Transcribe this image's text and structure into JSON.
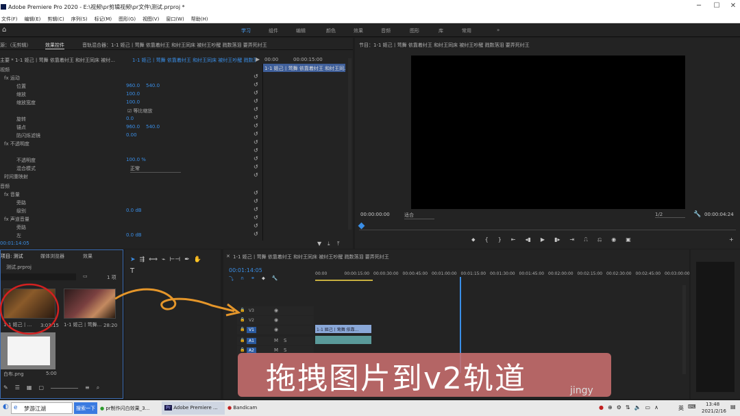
{
  "window": {
    "title": "Adobe Premiere Pro 2020 - E:\\视频\\pr剪辑视频\\pr文件\\测试.prproj *"
  },
  "menu": [
    "文件(F)",
    "编辑(E)",
    "剪辑(C)",
    "序列(S)",
    "标记(M)",
    "图形(G)",
    "视图(V)",
    "窗口(W)",
    "帮助(H)"
  ],
  "workspaces": [
    "学习",
    "组件",
    "编辑",
    "颜色",
    "效果",
    "音频",
    "图形",
    "库",
    "常用"
  ],
  "workspace_more": "»",
  "source_panel": {
    "tab_source": "源：（无剪辑）",
    "tab_effect_controls": "效果控件",
    "tab_audio_mixer": "音轨混合器：1-1 姬己丨莺舞 依靠着纣王 和纣王同床 被纣王吵醒 戮数落泪 要弄死纣王",
    "header_left": "主要 * 1-1 姬己丨莺舞 依靠着纣王 和纣王同床 被纣...",
    "header_right": "1-1 姬己丨莺舞 依靠着纣王 和纣王同床 被纣王吵醒 戮数落泪 ...",
    "time_a": "00:00",
    "time_b": "00:00:15:00",
    "clip_bar": "1-1 姬己丨莺舞 依靠着纣王 和纣王同...",
    "current_time": "00:01:14:05",
    "rows": [
      {
        "label": "视频",
        "value": "",
        "value2": "",
        "indent": 0
      },
      {
        "label": "fx 运动",
        "value": "",
        "value2": "",
        "indent": 1
      },
      {
        "label": "位置",
        "value": "960.0",
        "value2": "540.0",
        "indent": 2
      },
      {
        "label": "缩放",
        "value": "100.0",
        "value2": "",
        "indent": 2
      },
      {
        "label": "缩放宽度",
        "value": "100.0",
        "value2": "",
        "indent": 2
      },
      {
        "label": "☑ 等比缩放",
        "value": "",
        "value2": "",
        "indent": 4
      },
      {
        "label": "旋转",
        "value": "0.0",
        "value2": "",
        "indent": 2
      },
      {
        "label": "锚点",
        "value": "960.0",
        "value2": "540.0",
        "indent": 2
      },
      {
        "label": "防闪烁滤镜",
        "value": "0.00",
        "value2": "",
        "indent": 2
      },
      {
        "label": "fx 不透明度",
        "value": "",
        "value2": "",
        "indent": 1
      },
      {
        "label": "",
        "value": "",
        "value2": "",
        "indent": 2
      },
      {
        "label": "不透明度",
        "value": "100.0 %",
        "value2": "",
        "indent": 2
      },
      {
        "label": "混合模式",
        "value": "正常",
        "value2": "",
        "indent": 3
      },
      {
        "label": "时间重映射",
        "value": "",
        "value2": "",
        "indent": 1
      },
      {
        "label": "音频",
        "value": "",
        "value2": "",
        "indent": 0
      },
      {
        "label": "fx 音量",
        "value": "",
        "value2": "",
        "indent": 1
      },
      {
        "label": "旁路",
        "value": "",
        "value2": "",
        "indent": 2
      },
      {
        "label": "级别",
        "value": "0.0 dB",
        "value2": "",
        "indent": 2
      },
      {
        "label": "fx 声道音量",
        "value": "",
        "value2": "",
        "indent": 1
      },
      {
        "label": "旁路",
        "value": "",
        "value2": "",
        "indent": 2
      },
      {
        "label": "左",
        "value": "0.0 dB",
        "value2": "",
        "indent": 2
      }
    ]
  },
  "program": {
    "title": "节目：1-1 姬己丨莺舞 依靠着纣王 和纣王同床 被纣王吵醒 戮数落泪 要弄死纣王",
    "timecode_left": "00:00:00:00",
    "fit": "适合",
    "ratio": "1/2",
    "timecode_right": "00:00:04:24"
  },
  "project": {
    "tabs": [
      "项目: 测试",
      "媒体浏览器",
      "效果"
    ],
    "file": "测试.prproj",
    "count": "1 项",
    "items": [
      {
        "name": "1-1 姬己丨...",
        "duration": "3:03:15"
      },
      {
        "name": "1-1 姬己丨莺舞...",
        "duration": "28:20"
      },
      {
        "name": "白布.png",
        "duration": "5:00"
      }
    ]
  },
  "timeline": {
    "title": "1-1 姬己丨莺舞 依靠着纣王 和纣王同床 被纣王吵醒 戮数落泪 要弄死纣王",
    "current_time": "00:01:14:05",
    "ruler": [
      "00:00",
      "00:00:15:00",
      "00:00:30:00",
      "00:00:45:00",
      "00:01:00:00",
      "00:01:15:00",
      "00:01:30:00",
      "00:01:45:00",
      "00:02:00:00",
      "00:02:15:00",
      "00:02:30:00",
      "00:02:45:00",
      "00:03:00:00"
    ],
    "tracks": [
      "V3",
      "V2",
      "V1",
      "A1",
      "A2"
    ],
    "clip_label": "1-1 姬己丨莺舞 依靠..."
  },
  "overlay": {
    "banner": "拖拽图片到v2轨道",
    "watermark": "jingy"
  },
  "taskbar": {
    "search": "梦游江湖",
    "search_btn": "搜索一下",
    "apps": [
      "pr制作闪白效果_3...",
      "Adobe Premiere ...",
      "Bandicam"
    ],
    "ime": "英",
    "time": "13:48",
    "date": "2021/2/16"
  }
}
